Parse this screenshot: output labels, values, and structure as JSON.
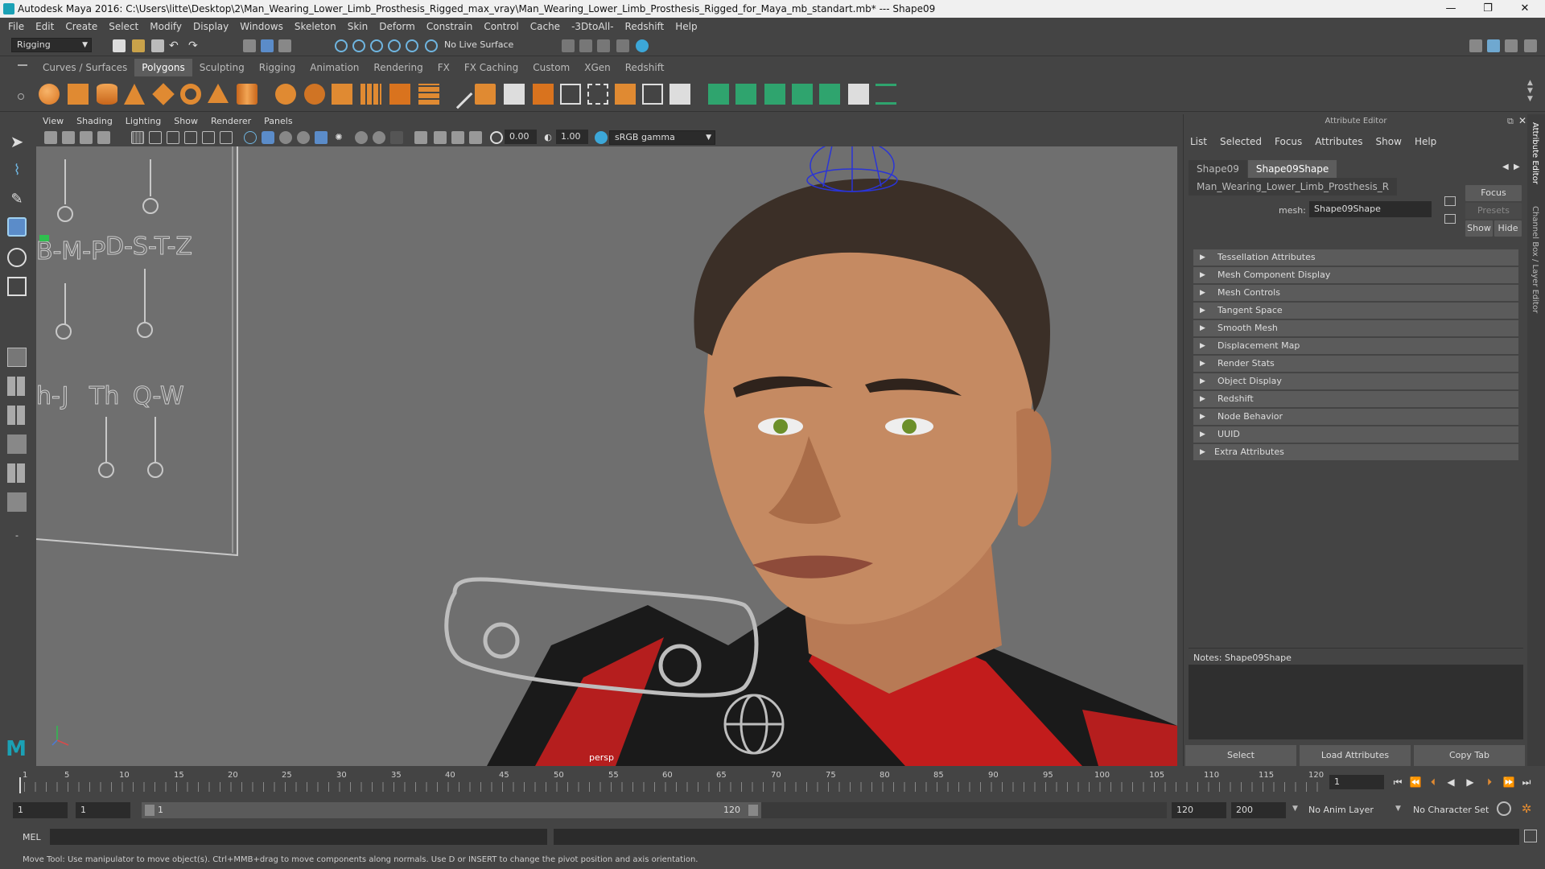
{
  "window": {
    "title": "Autodesk Maya 2016: C:\\Users\\litte\\Desktop\\2\\Man_Wearing_Lower_Limb_Prosthesis_Rigged_max_vray\\Man_Wearing_Lower_Limb_Prosthesis_Rigged_for_Maya_mb_standart.mb*   ---   Shape09",
    "minimize": "—",
    "restore": "❐",
    "close": "✕"
  },
  "menubar": [
    "File",
    "Edit",
    "Create",
    "Select",
    "Modify",
    "Display",
    "Windows",
    "Skeleton",
    "Skin",
    "Deform",
    "Constrain",
    "Control",
    "Cache",
    "-3DtoAll-",
    "Redshift",
    "Help"
  ],
  "statusline": {
    "menu_set": "Rigging",
    "live_surface": "No Live Surface"
  },
  "shelf_tabs": [
    "Curves / Surfaces",
    "Polygons",
    "Sculpting",
    "Rigging",
    "Animation",
    "Rendering",
    "FX",
    "FX Caching",
    "Custom",
    "XGen",
    "Redshift"
  ],
  "shelf_active": "Polygons",
  "viewport": {
    "menu": [
      "View",
      "Shading",
      "Lighting",
      "Show",
      "Renderer",
      "Panels"
    ],
    "exposure": "0.00",
    "gamma": "1.00",
    "color_space": "sRGB gamma",
    "camera_label": "persp",
    "phoneme_labels": [
      "B-M-P",
      "D-S-T-Z",
      "h-J",
      "Th",
      "Q-W"
    ]
  },
  "attribute_editor": {
    "title": "Attribute Editor",
    "menu": [
      "List",
      "Selected",
      "Focus",
      "Attributes",
      "Show",
      "Help"
    ],
    "tabs": [
      "Shape09",
      "Shape09Shape",
      "Man_Wearing_Lower_Limb_Prosthesis_R"
    ],
    "active_tab": "Shape09Shape",
    "mesh_label": "mesh:",
    "mesh_value": "Shape09Shape",
    "focus_button": "Focus",
    "presets_button": "Presets",
    "show_button": "Show",
    "hide_button": "Hide",
    "sections": [
      "Tessellation Attributes",
      "Mesh Component Display",
      "Mesh Controls",
      "Tangent Space",
      "Smooth Mesh",
      "Displacement Map",
      "Render Stats",
      "Object Display",
      "Redshift",
      "Node Behavior",
      "UUID",
      "Extra Attributes"
    ],
    "notes_label": "Notes:  Shape09Shape",
    "bottom_buttons": [
      "Select",
      "Load Attributes",
      "Copy Tab"
    ]
  },
  "side_tabs": [
    "Attribute Editor",
    "Channel Box / Layer Editor"
  ],
  "timeline": {
    "ticks": [
      "1",
      "5",
      "10",
      "15",
      "20",
      "25",
      "30",
      "35",
      "40",
      "45",
      "50",
      "55",
      "60",
      "65",
      "70",
      "75",
      "80",
      "85",
      "90",
      "95",
      "100",
      "105",
      "110",
      "115",
      "120"
    ],
    "current_frame": "1"
  },
  "range": {
    "start": "1",
    "playback_start": "1",
    "slider_start": "1",
    "slider_end": "120",
    "playback_end": "120",
    "end": "200",
    "anim_layer": "No Anim Layer",
    "character_set": "No Character Set"
  },
  "command_line": {
    "language": "MEL"
  },
  "help_line": "Move Tool: Use manipulator to move object(s). Ctrl+MMB+drag to move components along normals. Use D or INSERT to change the pivot position and axis orientation."
}
